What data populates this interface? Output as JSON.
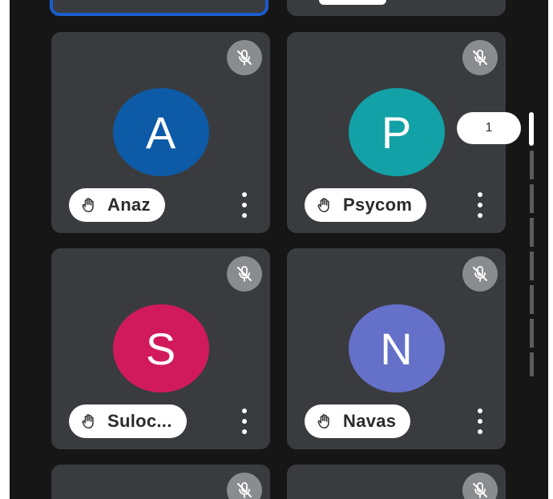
{
  "participants": [
    {
      "initial": "A",
      "name": "Anaz",
      "color": "#0d5aa7"
    },
    {
      "initial": "P",
      "name": "Psycom",
      "color": "#12a1a6"
    },
    {
      "initial": "S",
      "name": "Suloc...",
      "color": "#d11a5b"
    },
    {
      "initial": "N",
      "name": "Navas",
      "color": "#6570c9"
    }
  ],
  "page_indicator": "1",
  "icons": {
    "mute": "mic-off-icon",
    "hand": "hand-raise-icon",
    "more": "more-vert-icon"
  },
  "colors": {
    "background": "#161616",
    "tile": "#3a3b3f",
    "active_border": "#1a5dcc",
    "mute_bg": "#8b8c90"
  }
}
